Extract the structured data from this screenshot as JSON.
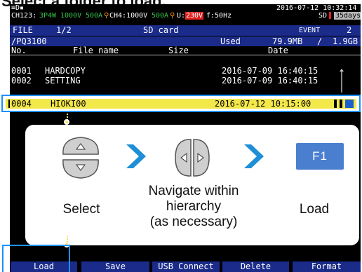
{
  "heading": "Select a folder to load.",
  "status": {
    "battery": "≡D▪",
    "ch123_label": "CH123:",
    "ch123_wiring": "3P4W",
    "ch123_voltage": "1000V",
    "ch123_current": "500A",
    "ch4_label": "CH4:1000V",
    "ch4_current": "500A",
    "u_label": "U:",
    "u_value": "230V",
    "freq": "f:50Hz",
    "datetime": "2016-07-12 10:32:14",
    "sd_label": "SD",
    "days": "35days",
    "event_label": "EVENT",
    "event_count": "2"
  },
  "filebar": {
    "label": "FILE",
    "page": "1/2",
    "title": "SD card"
  },
  "pathbar": {
    "path": "/PQ3100",
    "used_label": "Used",
    "used_value": "79.9MB",
    "sep": "/",
    "total": "1.9GB"
  },
  "columns": {
    "no": "No.",
    "file_name": "File name",
    "size": "Size",
    "date": "Date"
  },
  "rows": [
    {
      "no": "0001",
      "name": "HARDCOPY",
      "date": "2016-07-09 16:40:15"
    },
    {
      "no": "0002",
      "name": "SETTING",
      "date": "2016-07-09 16:40:15"
    }
  ],
  "selected_row": {
    "no": "0004",
    "name": "HIOKI00",
    "date": "2016-07-12 10:15:00"
  },
  "steps": {
    "select": "Select",
    "navigate_line1": "Navigate within",
    "navigate_line2": "hierarchy",
    "navigate_line3": "(as necessary)",
    "load": "Load",
    "f1": "F1"
  },
  "fn_keys": [
    "Load",
    "Save",
    "USB Connect",
    "Delete",
    "Format"
  ],
  "colors": {
    "accent": "#1e90ff",
    "arrow": "#1e8fd6",
    "bar": "#1a2b8a",
    "highlight": "#f3e84a",
    "f1": "#4a7fd0"
  }
}
